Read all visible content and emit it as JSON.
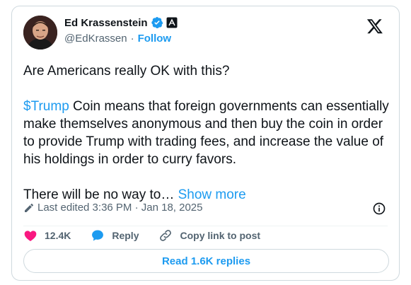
{
  "author": {
    "name": "Ed Krassenstein",
    "handle": "@EdKrassen",
    "separator": "·",
    "follow_label": "Follow"
  },
  "icons": {
    "verified": "verified-badge-icon",
    "affiliation": "affiliation-badge-icon",
    "platform": "x-logo-icon",
    "edit": "pencil-icon",
    "info": "info-icon",
    "like": "heart-icon",
    "reply": "reply-bubble-icon",
    "link": "link-icon"
  },
  "colors": {
    "accent": "#1d9bf0",
    "like": "#f91880",
    "text": "#0f1419",
    "muted": "#536471",
    "border": "#cfd9de"
  },
  "tweet": {
    "line1": "Are Americans really OK with this?",
    "cashtag": "$Trump",
    "line2_rest": " Coin means that foreign governments can essentially make themselves anonymous and then buy the coin in order to provide Trump with trading fees, and increase the value of his holdings in order to curry favors.",
    "line3": "There will be no way to…",
    "show_more": "Show more"
  },
  "meta": {
    "edited_label": "Last edited 3:36 PM · Jan 18, 2025"
  },
  "actions": {
    "like_count": "12.4K",
    "reply_label": "Reply",
    "copy_label": "Copy link to post"
  },
  "replies": {
    "read_label": "Read 1.6K replies"
  }
}
